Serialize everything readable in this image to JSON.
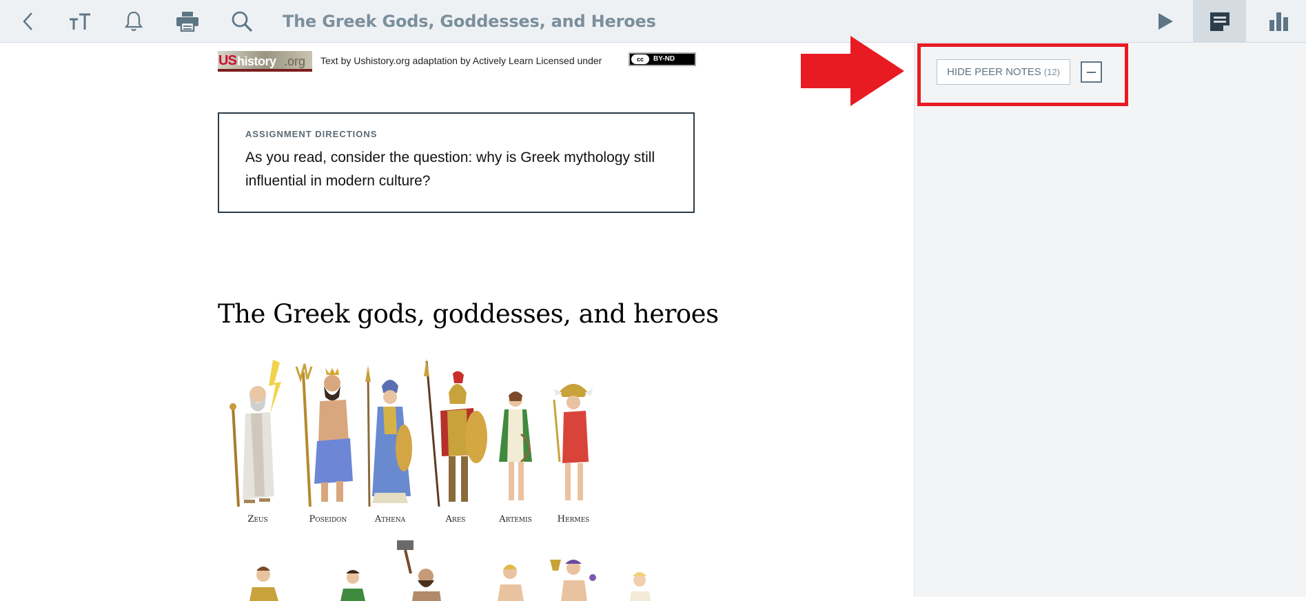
{
  "toolbar": {
    "title": "The Greek Gods, Goddesses, and Heroes",
    "icons": [
      "back-icon",
      "text-size-icon",
      "bell-icon",
      "printer-icon",
      "search-icon",
      "play-icon",
      "notes-icon",
      "chart-icon"
    ]
  },
  "attribution": {
    "logo_us": "US",
    "logo_history": "history",
    "logo_org": ".org",
    "text": "Text by Ushistory.org adaptation by Actively Learn Licensed under",
    "license_cc": "cc",
    "license_type": "BY-ND"
  },
  "directions": {
    "label": "ASSIGNMENT DIRECTIONS",
    "text": "As you read, consider the question: why is Greek mythology still influential in modern culture?"
  },
  "article": {
    "heading": "The Greek gods, goddesses, and heroes"
  },
  "gods": [
    {
      "name": "Zeus"
    },
    {
      "name": "Poseidon"
    },
    {
      "name": "Athena"
    },
    {
      "name": "Ares"
    },
    {
      "name": "Artemis"
    },
    {
      "name": "Hermes"
    }
  ],
  "sidebar": {
    "hide_peer_notes_label": "HIDE PEER NOTES",
    "peer_notes_count": "(12)"
  },
  "colors": {
    "toolbar_bg": "#eef1f4",
    "toolbar_icon": "#5d7585",
    "highlight_red": "#e81b23",
    "sidebar_bg": "#f2f4f6"
  }
}
